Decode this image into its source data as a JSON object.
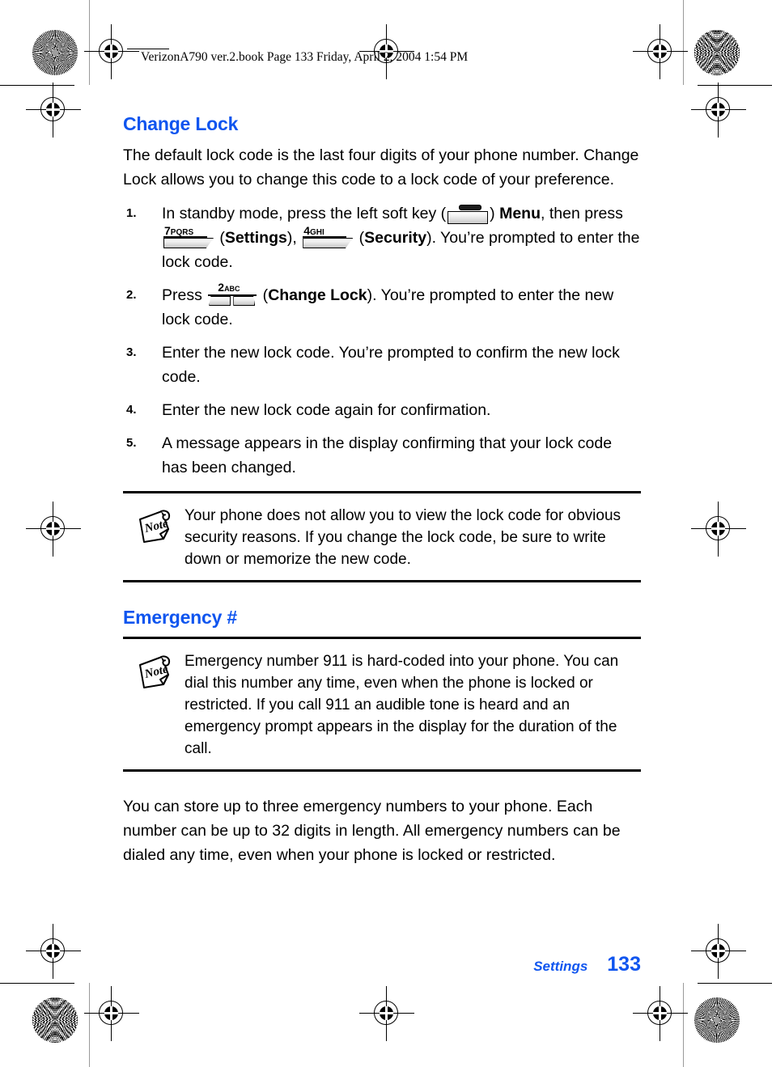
{
  "book_header": {
    "text": "VerizonA790 ver.2.book  Page 133  Friday, April 2, 2004  1:54 PM"
  },
  "sections": {
    "change_lock": {
      "title": "Change Lock",
      "intro": "The default lock code is the last four digits of your phone number. Change Lock allows you to change this code to a lock code of your preference.",
      "steps": [
        {
          "num": "1.",
          "part_a": "In standby mode, press the left soft key (",
          "part_b": ") ",
          "bold_b": "Menu",
          "part_c": ", then press ",
          "key_7": {
            "digit": "7",
            "letters": "PQRS"
          },
          "part_d": " (",
          "bold_d": "Settings",
          "part_e": "), ",
          "key_4": {
            "digit": "4",
            "letters": "GHI"
          },
          "part_f": " (",
          "bold_f": "Security",
          "part_g": "). You’re prompted to enter the lock code."
        },
        {
          "num": "2.",
          "part_a": "Press ",
          "key_2": {
            "digit": "2",
            "letters": "ABC"
          },
          "part_b": " (",
          "bold_b": "Change Lock",
          "part_c": "). You’re prompted to enter the new lock code."
        },
        {
          "num": "3.",
          "text": "Enter the new lock code. You’re prompted to confirm the new lock code."
        },
        {
          "num": "4.",
          "text": "Enter the new lock code again for confirmation."
        },
        {
          "num": "5.",
          "text": "A message appears in the display confirming that your lock code has been changed."
        }
      ],
      "note": "Your phone does not allow you to view the lock code for obvious security reasons. If you change the lock code, be sure to write down or memorize the new code."
    },
    "emergency": {
      "title": "Emergency #",
      "note": "Emergency number 911 is hard-coded into your phone. You can dial this number any time, even when the phone is locked or restricted. If you call 911 an audible tone is heard and an emergency prompt appears in the display for the duration of the call.",
      "body": "You can store up to three emergency numbers to your phone. Each number can be up to 32 digits in length. All emergency numbers can be dialed any time, even when your phone is locked or restricted."
    }
  },
  "note_icon_label": "Note",
  "footer": {
    "section": "Settings",
    "page": "133"
  },
  "colors": {
    "heading_blue": "#0f55ef",
    "text_black": "#000000",
    "page_background": "#ffffff"
  }
}
